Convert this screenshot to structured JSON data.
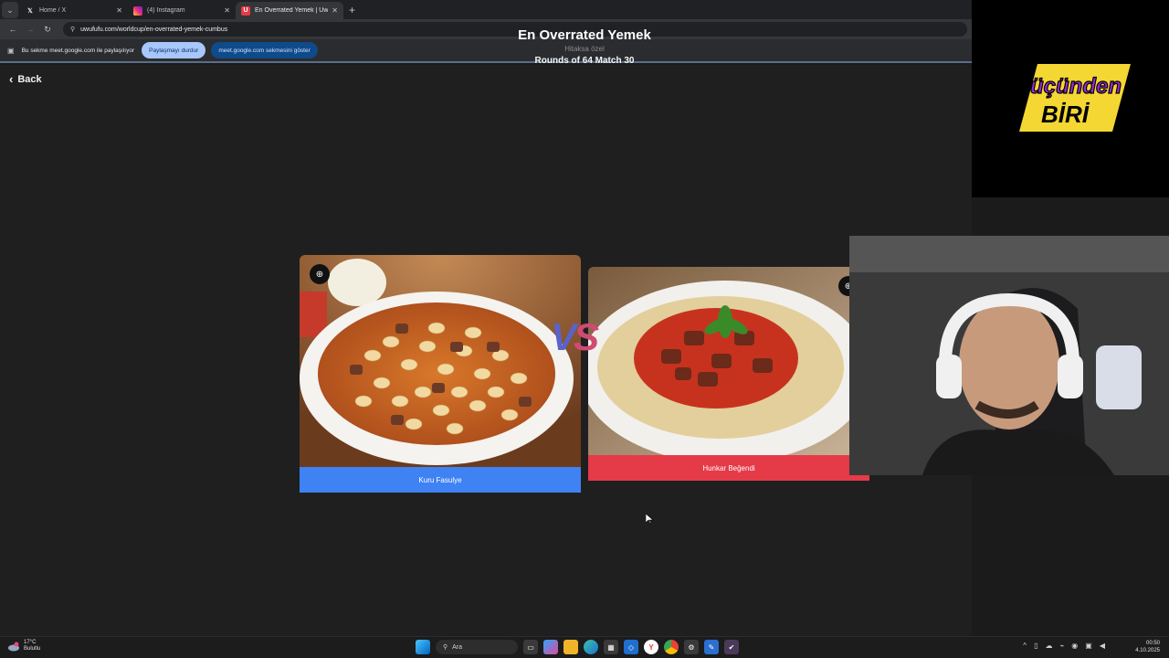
{
  "browser": {
    "tabs": [
      {
        "label": "Home / X",
        "icon": "x-logo-icon",
        "active": false
      },
      {
        "label": "(4) Instagram",
        "icon": "instagram-icon",
        "active": false
      },
      {
        "label": "En Overrated Yemek | UwU...",
        "icon": "uwufufu-icon",
        "active": true
      }
    ],
    "address": "uwufufu.com/worldcup/en-overrated-yemek-cumbus",
    "share_bar": {
      "text": "Bu sekme meet.google.com ile paylaşılıyor",
      "stop_label": "Paylaşmayı durdur",
      "show_label": "meet.google.com sekmesini göster"
    }
  },
  "page": {
    "back_label": "Back",
    "title": "En Overrated Yemek",
    "subtitle": "Hitaksa özel",
    "rounds": "Rounds of 64 Match 30",
    "vs": {
      "v": "V",
      "s": "S"
    },
    "left_choice": {
      "label": "Kuru Fasulye"
    },
    "right_choice": {
      "label": "Hunkar Beğendi"
    }
  },
  "overlay": {
    "logo_line1": "üçünden",
    "logo_line2": "BİRİ"
  },
  "taskbar": {
    "weather_temp": "17°C",
    "weather_desc": "Bulutlu",
    "search_label": "Ara",
    "time": "00:50",
    "date": "4.10.2025"
  },
  "colors": {
    "left_label": "#3e82f4",
    "right_label": "#e53a48",
    "logo_yellow": "#f4d733",
    "logo_purple": "#9b2bd6"
  }
}
